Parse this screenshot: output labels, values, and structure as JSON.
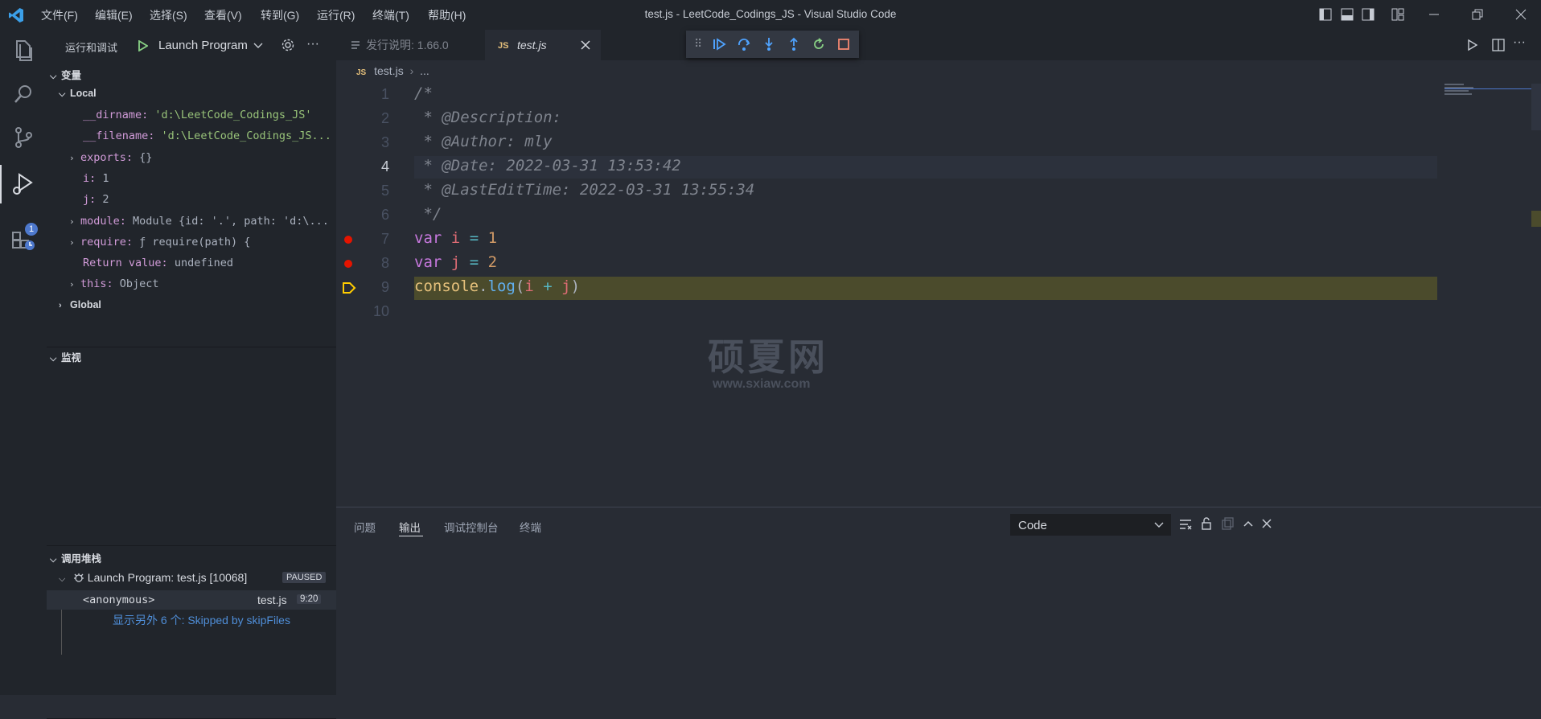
{
  "titlebar": {
    "menus": [
      "文件(F)",
      "编辑(E)",
      "选择(S)",
      "查看(V)",
      "转到(G)",
      "运行(R)",
      "终端(T)",
      "帮助(H)"
    ],
    "window_title": "test.js - LeetCode_Codings_JS - Visual Studio Code"
  },
  "activity": {
    "debug_badge": "1"
  },
  "sidebar": {
    "header": "运行和调试",
    "launch_config": "Launch Program",
    "variables_title": "变量",
    "local_title": "Local",
    "variables": [
      {
        "name": "__dirname:",
        "value": "'d:\\LeetCode_Codings_JS'"
      },
      {
        "name": "__filename:",
        "value": "'d:\\LeetCode_Codings_JS..."
      },
      {
        "name": "exports:",
        "value": "{}"
      },
      {
        "name": "i:",
        "value": "1"
      },
      {
        "name": "j:",
        "value": "2"
      },
      {
        "name": "module:",
        "value": "Module {id: '.', path: 'd:\\..."
      },
      {
        "name": "require:",
        "value": "ƒ require(path) {"
      },
      {
        "name": "Return value:",
        "value": "undefined"
      },
      {
        "name": "this:",
        "value": "Object"
      }
    ],
    "global_title": "Global",
    "watch_title": "监视",
    "callstack_title": "调用堆栈",
    "callstack": {
      "session": "Launch Program: test.js [10068]",
      "status": "PAUSED",
      "frame_name": "<anonymous>",
      "frame_file": "test.js",
      "frame_pos": "9:20",
      "skipped": "显示另外 6 个: Skipped by skipFiles"
    }
  },
  "tabs": [
    {
      "label": "发行说明: 1.66.0"
    },
    {
      "label": "test.js"
    }
  ],
  "breadcrumb": {
    "file": "test.js",
    "rest": "..."
  },
  "editor": {
    "line_numbers": [
      "1",
      "2",
      "3",
      "4",
      "5",
      "6",
      "7",
      "8",
      "9",
      "10"
    ],
    "lines": {
      "l1": "/*",
      "l2": " * @Description:",
      "l3": " * @Author: mly",
      "l4": " * @Date: 2022-03-31 13:53:42",
      "l5": " * @LastEditTime: 2022-03-31 13:55:34",
      "l6": " */",
      "l7": {
        "kw": "var",
        "name": "i",
        "op": "=",
        "num": "1"
      },
      "l8": {
        "kw": "var",
        "name": "j",
        "op": "=",
        "num": "2"
      },
      "l9": {
        "obj": "console",
        "dot": ".",
        "fn": "log",
        "open": "(",
        "a": "i",
        "plus": "+",
        "b": "j",
        "close": ")"
      }
    },
    "watermark_cn": "硕夏网",
    "watermark_url": "www.sxiaw.com"
  },
  "panel": {
    "tabs": [
      "问题",
      "输出",
      "调试控制台",
      "终端"
    ],
    "output_channel": "Code"
  },
  "colors": {
    "accent": "#4d78cc",
    "breakpoint": "#e51400",
    "current_line": "#4b4b2c"
  }
}
